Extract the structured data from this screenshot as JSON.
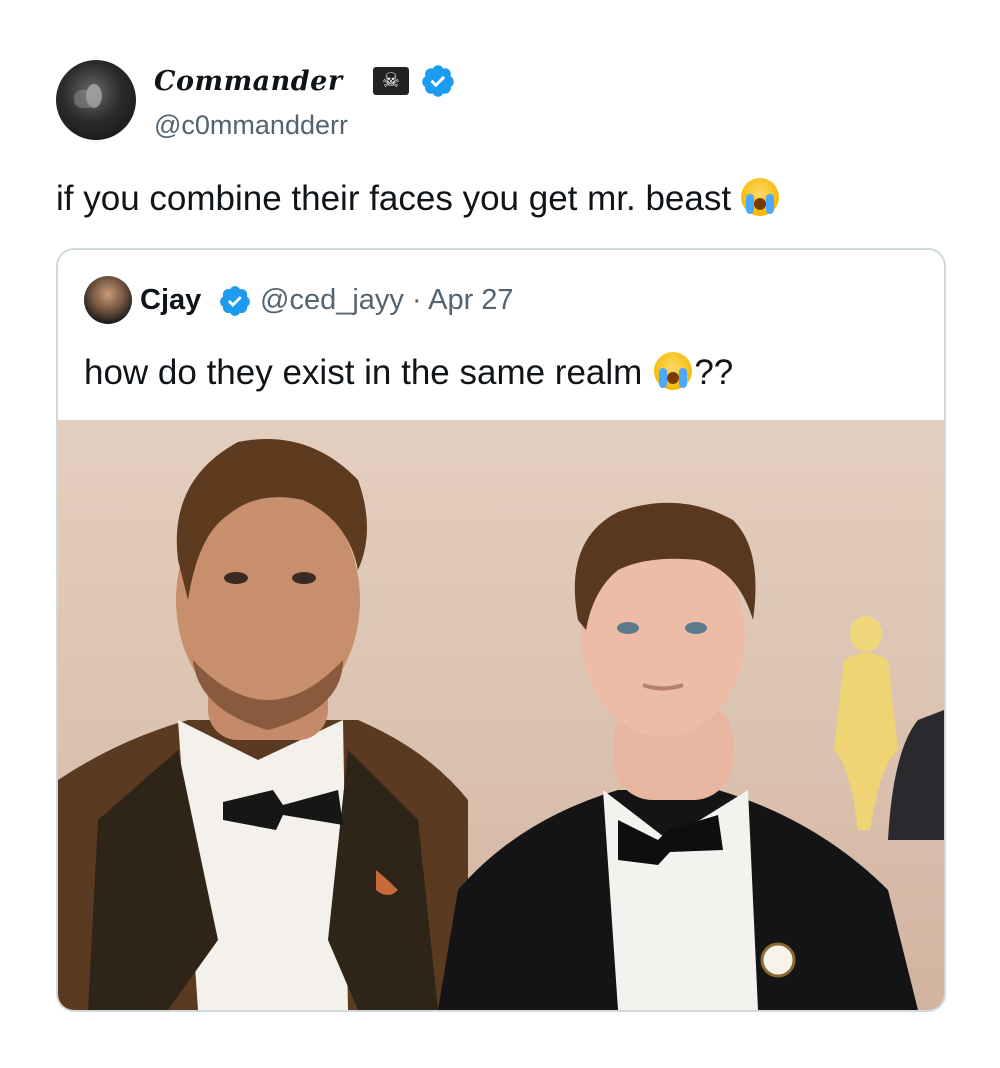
{
  "tweet": {
    "author_name": "Commander",
    "author_handle": "@c0mmandderr",
    "text": "if you combine their faces you get mr. beast",
    "name_badges": [
      "pirate-flag-icon",
      "verified-badge-icon"
    ],
    "emoji": "loudly-crying-face-icon"
  },
  "quoted_tweet": {
    "author_name": "Cjay",
    "author_handle": "@ced_jayy",
    "date_separator": "·",
    "date": "Apr 27",
    "text_before_emoji": "how do they exist in the same realm",
    "text_after_emoji": "??",
    "emoji": "loudly-crying-face-icon",
    "media": "photo"
  },
  "colors": {
    "verified_blue": "#1d9bf0",
    "secondary_text": "#536471",
    "border": "#cfd9de"
  }
}
